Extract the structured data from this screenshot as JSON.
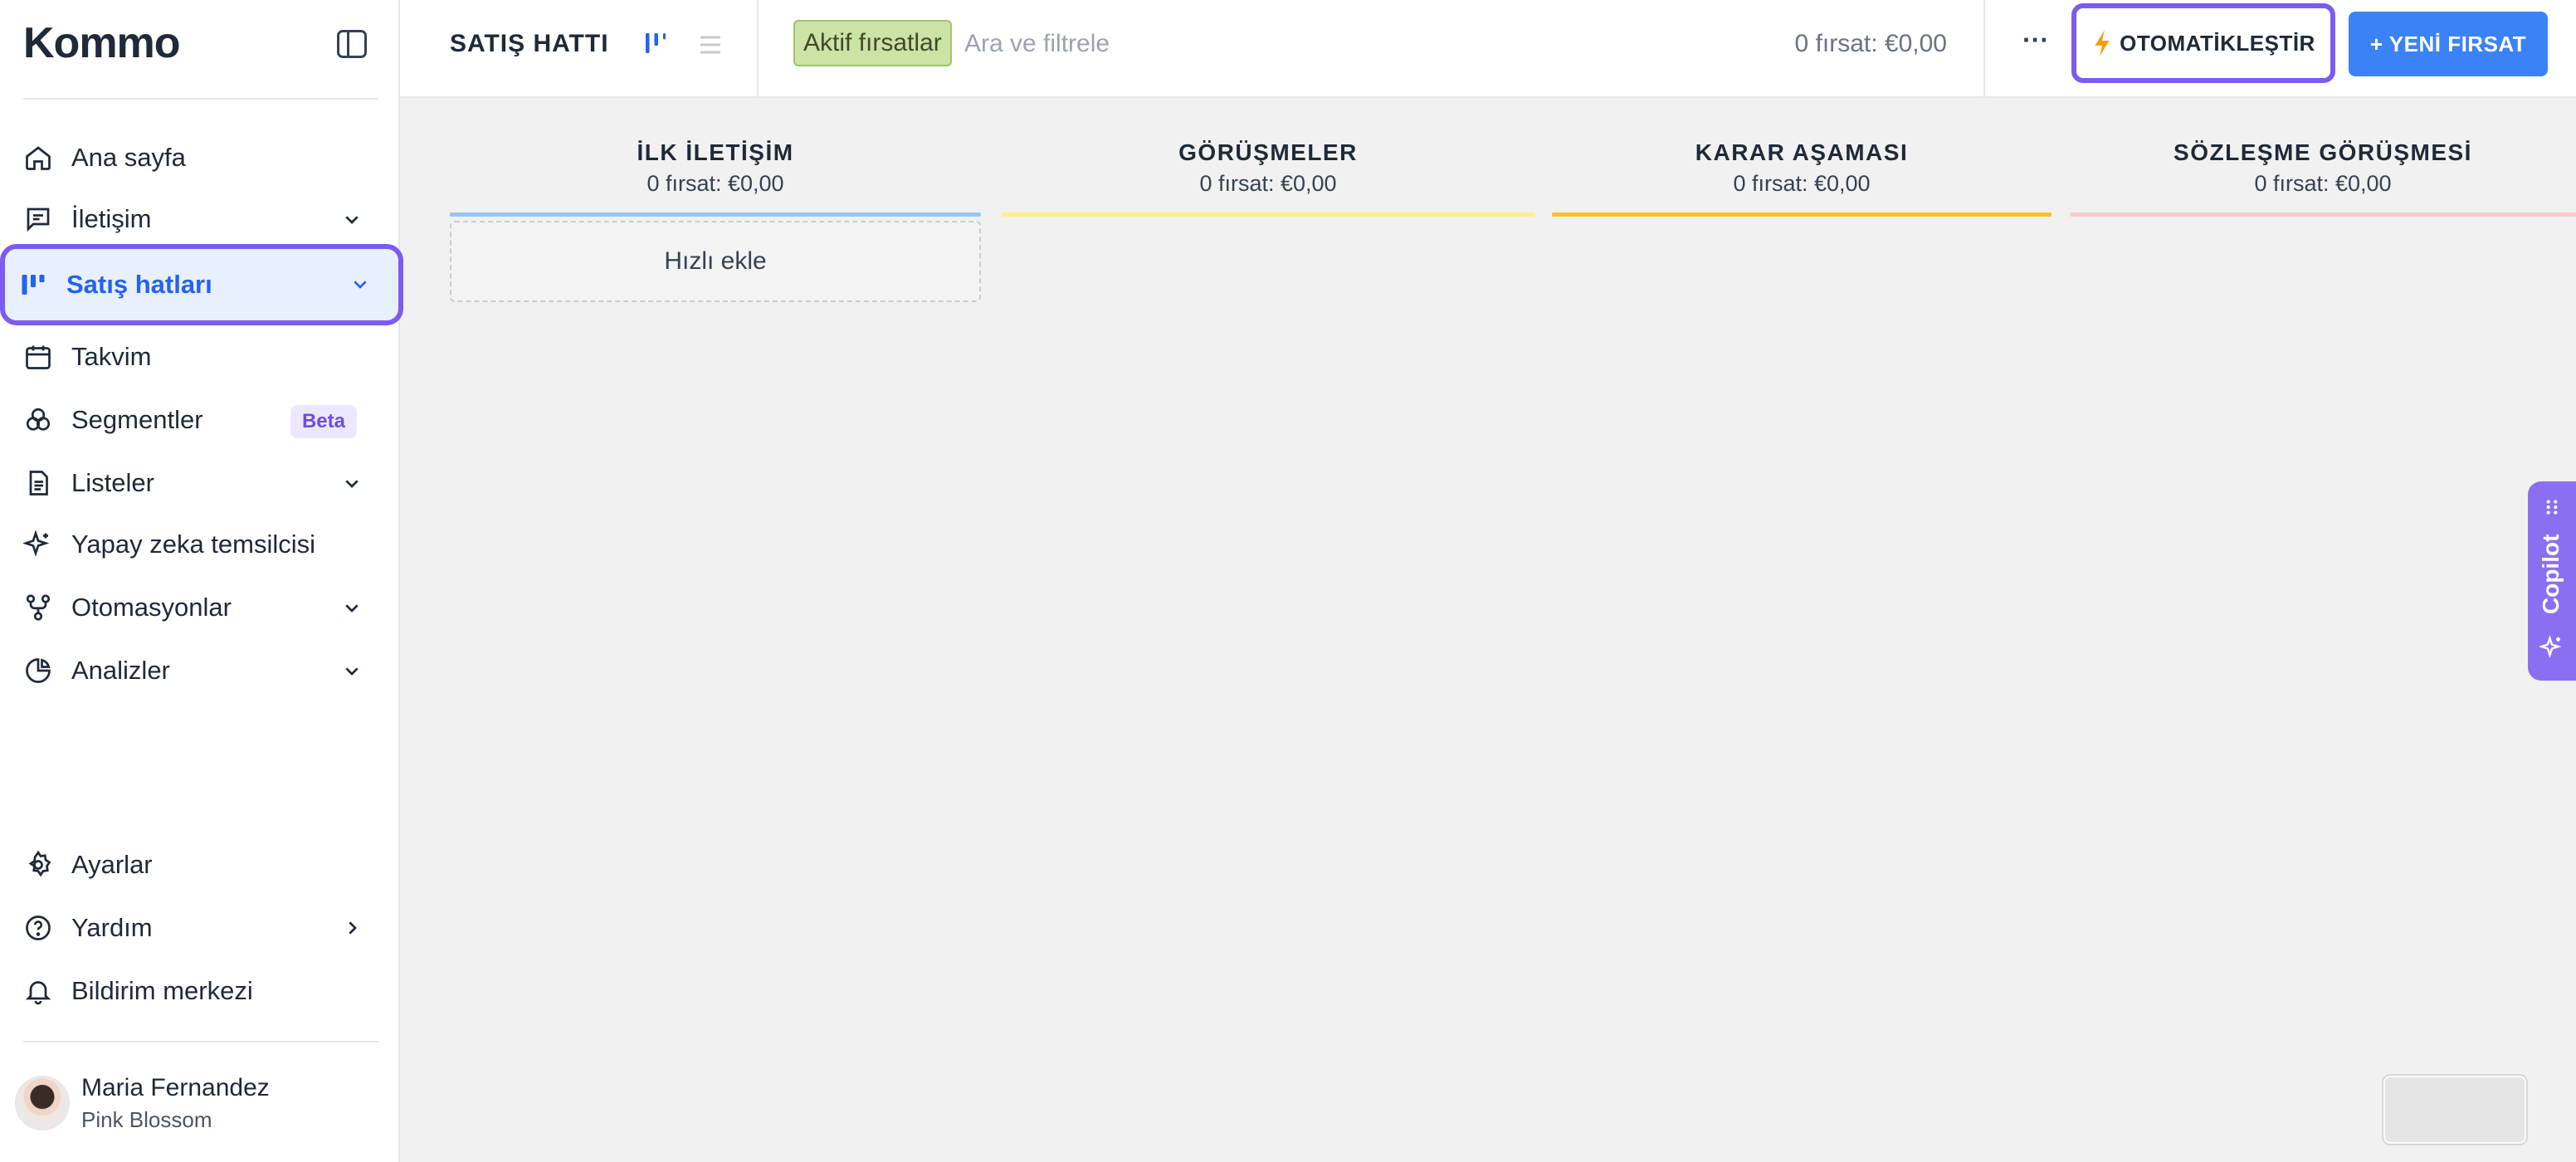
{
  "brand": {
    "logo_text": "Kommo"
  },
  "sidebar": {
    "items": [
      {
        "label": "Ana sayfa",
        "icon": "home-icon"
      },
      {
        "label": "İletişim",
        "icon": "chat-icon",
        "has_chevron": true
      },
      {
        "label": "Satış hatları",
        "icon": "pipeline-icon",
        "has_chevron": true,
        "active": true
      },
      {
        "label": "Takvim",
        "icon": "calendar-icon"
      },
      {
        "label": "Segmentler",
        "icon": "segments-icon",
        "badge": "Beta"
      },
      {
        "label": "Listeler",
        "icon": "document-icon",
        "has_chevron": true
      },
      {
        "label": "Yapay zeka temsilcisi",
        "icon": "sparkle-icon"
      },
      {
        "label": "Otomasyonlar",
        "icon": "automation-icon",
        "has_chevron": true
      },
      {
        "label": "Analizler",
        "icon": "pie-chart-icon",
        "has_chevron": true
      }
    ],
    "bottom_items": [
      {
        "label": "Ayarlar",
        "icon": "gear-icon"
      },
      {
        "label": "Yardım",
        "icon": "help-icon",
        "has_chevron_right": true
      },
      {
        "label": "Bildirim merkezi",
        "icon": "bell-icon"
      }
    ],
    "user": {
      "name": "Maria Fernandez",
      "company": "Pink Blossom"
    }
  },
  "topbar": {
    "pipeline_title": "SATIŞ HATTI",
    "active_filter": "Aktif fırsatlar",
    "search_placeholder": "Ara ve filtrele",
    "total_summary": "0 fırsat: €0,00",
    "more_label": "···",
    "automate_label": "OTOMATİKLEŞTİR",
    "new_deal_label": "+ YENİ FIRSAT"
  },
  "board": {
    "columns": [
      {
        "title": "İLK İLETİŞİM",
        "summary": "0 fırsat: €0,00",
        "color": "#93c5fd"
      },
      {
        "title": "GÖRÜŞMELER",
        "summary": "0 fırsat: €0,00",
        "color": "#fef08a"
      },
      {
        "title": "KARAR AŞAMASI",
        "summary": "0 fırsat: €0,00",
        "color": "#fbbf24"
      },
      {
        "title": "SÖZLEŞME GÖRÜŞMESİ",
        "summary": "0 fırsat: €0,00",
        "color": "#fecaca"
      }
    ],
    "quick_add_label": "Hızlı ekle"
  },
  "copilot": {
    "label": "Copilot",
    "color": "#8b6ff2"
  },
  "colors": {
    "accent": "#7c5cf0",
    "primary": "#3b82f6",
    "active_text": "#2563eb"
  }
}
